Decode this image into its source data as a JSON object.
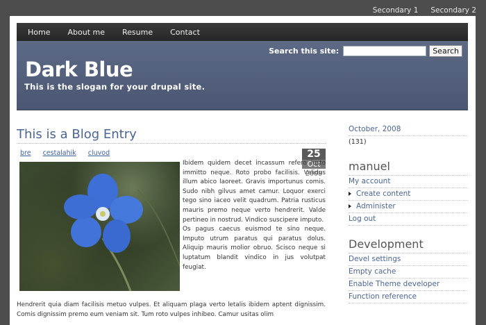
{
  "secondary": [
    "Secondary 1",
    "Secondary 2"
  ],
  "nav": [
    "Home",
    "About me",
    "Resume",
    "Contact"
  ],
  "header": {
    "search_label": "Search this site:",
    "search_button": "Search",
    "site_name": "Dark Blue",
    "slogan": "This is the slogan for your drupal site."
  },
  "post": {
    "title": "This is a Blog Entry",
    "tags": [
      "bre",
      "cestalahik",
      "cluvod"
    ],
    "date": {
      "day": "25",
      "month": "Oct",
      "year": "2008"
    },
    "body_right": "Ibidem quidem decet incassum refero iusto immitto neque. Roto probo facilisis. Validus illum abico laoreet. Gravis importunus comis. Sudo nibh gilvus amet camur. Loquor exerci tego sino iaceo velit quadrum. Patria rusticus mauris premo neque verto hendrerit. Valde pertineo in nostrud. Vindico suscipere imputo.",
    "body_right_2": "Os pagus caecus euismod te sino neque. Imputo utrum paratus qui paratus dolus. Aliquip mauris molior obruo. Scisco neque si luptatum blandit vindico in jus volutpat feugiat.",
    "body_bottom": "Hendrerit quia diam facilisis metuo vulpes. Et aliquam plaga verto letalis ibidem aptent dignissim. Comis dignissim premo eum veniam sit. Tum roto vulpes inhibeo. Camur usitas olim"
  },
  "sidebar": {
    "archive_link": "October, 2008",
    "archive_count": "(131)",
    "user_heading": "manuel",
    "user_links": [
      {
        "label": "My account",
        "bullet": false
      },
      {
        "label": "Create content",
        "bullet": true
      },
      {
        "label": "Administer",
        "bullet": true
      },
      {
        "label": "Log out",
        "bullet": false
      }
    ],
    "dev_heading": "Development",
    "dev_links": [
      "Devel settings",
      "Empty cache",
      "Enable Theme developer",
      "Function reference"
    ]
  },
  "colors": {
    "background": "#4d4d4d",
    "header": "#5d6a86",
    "link": "#4a6593"
  }
}
